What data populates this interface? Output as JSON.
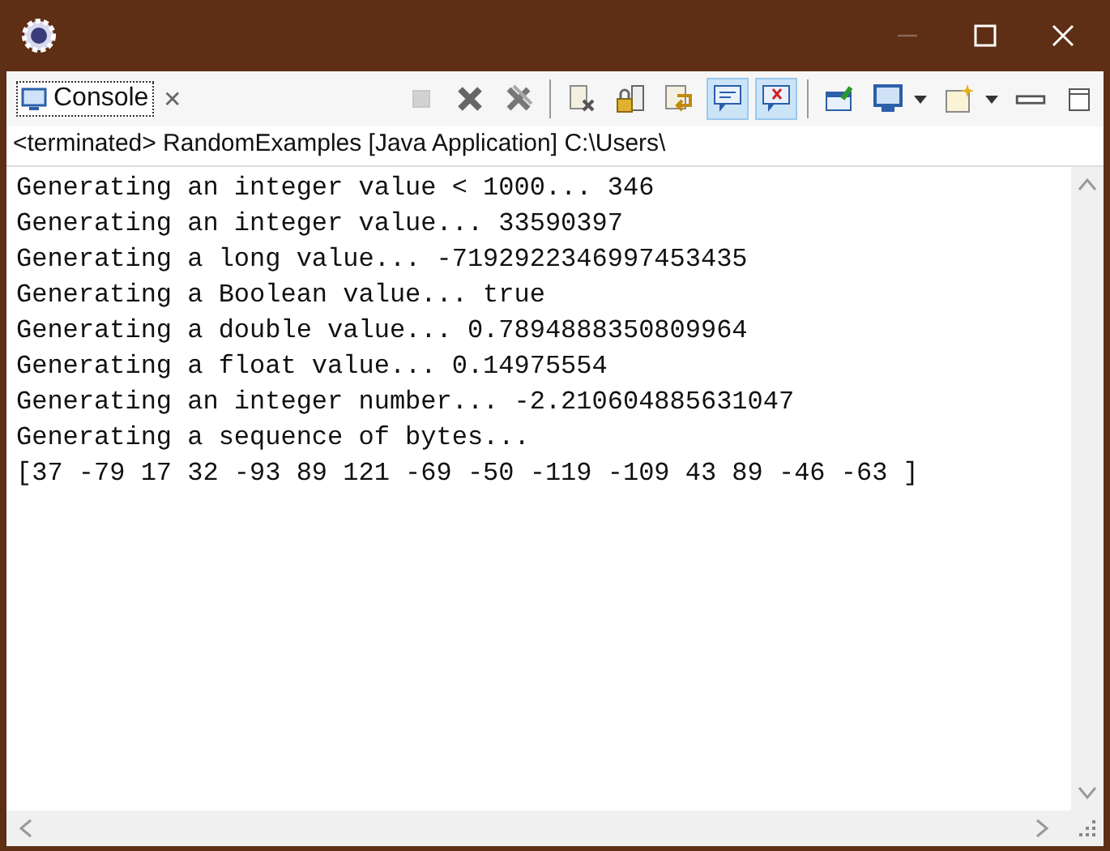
{
  "tab": {
    "label": "Console",
    "close": "✕"
  },
  "toolbar": [
    {
      "kind": "terminate",
      "on": false,
      "disabled": true
    },
    {
      "kind": "remove",
      "on": false,
      "disabled": false
    },
    {
      "kind": "remove-all",
      "on": false,
      "disabled": false
    },
    {
      "kind": "sep"
    },
    {
      "kind": "clear",
      "on": false,
      "disabled": false
    },
    {
      "kind": "lock",
      "on": false,
      "disabled": false
    },
    {
      "kind": "wrap",
      "on": false,
      "disabled": false
    },
    {
      "kind": "show-out",
      "on": true,
      "disabled": false
    },
    {
      "kind": "show-err",
      "on": true,
      "disabled": false
    },
    {
      "kind": "sep"
    },
    {
      "kind": "pin",
      "on": false,
      "disabled": false
    },
    {
      "kind": "display",
      "on": false,
      "disabled": false
    },
    {
      "kind": "caret"
    },
    {
      "kind": "new",
      "on": false,
      "disabled": false
    },
    {
      "kind": "caret"
    },
    {
      "kind": "minimize",
      "on": false,
      "disabled": false
    },
    {
      "kind": "maximize",
      "on": false,
      "disabled": false
    }
  ],
  "status": "<terminated> RandomExamples [Java Application] C:\\Users\\",
  "lines": [
    "Generating an integer value < 1000... 346",
    "Generating an integer value... 33590397",
    "Generating a long value... -7192922346997453435",
    "Generating a Boolean value... true",
    "Generating a double value... 0.7894888350809964",
    "Generating a float value... 0.14975554",
    "Generating an integer number... -2.210604885631047",
    "Generating a sequence of bytes...",
    "[37 -79 17 32 -93 89 121 -69 -50 -119 -109 43 89 -46 -63 ]"
  ]
}
